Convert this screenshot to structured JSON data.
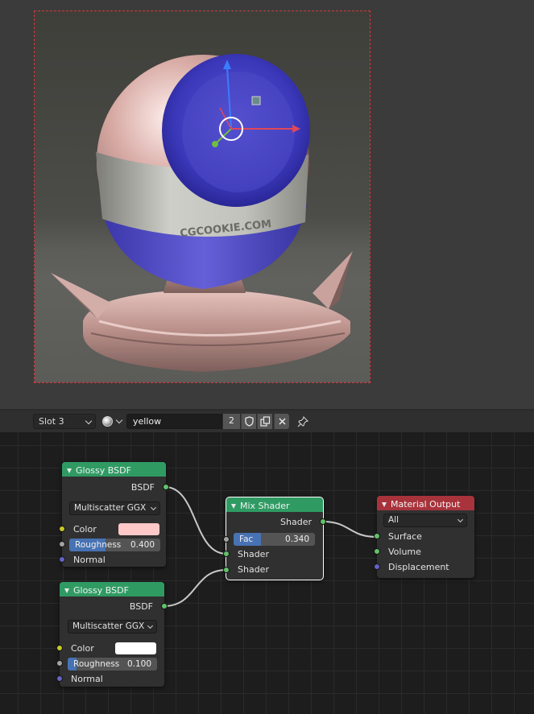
{
  "header": {
    "slot": "Slot 3",
    "material_name": "yellow",
    "user_count": "2",
    "icons": {
      "browse": "material-sphere-icon",
      "fake_user": "shield-icon",
      "duplicate": "duplicate-icon",
      "unlink": "close-icon",
      "pin": "pin-icon"
    }
  },
  "render": {
    "label_text": "CGCOOKIE.COM",
    "gizmo_colors": {
      "x": "#e0485a",
      "y": "#6fbe3f",
      "z": "#3a7dff"
    }
  },
  "nodes": {
    "glossy1": {
      "title": "Glossy BSDF",
      "output": "BSDF",
      "distribution": "Multiscatter GGX",
      "color_label": "Color",
      "color_value": "#ffc8c8",
      "roughness_label": "Roughness",
      "roughness": "0.400",
      "roughness_fraction": 0.4,
      "normal_label": "Normal"
    },
    "glossy2": {
      "title": "Glossy BSDF",
      "output": "BSDF",
      "distribution": "Multiscatter GGX",
      "color_label": "Color",
      "color_value": "#ffffff",
      "roughness_label": "Roughness",
      "roughness": "0.100",
      "roughness_fraction": 0.1,
      "normal_label": "Normal"
    },
    "mix": {
      "title": "Mix Shader",
      "output": "Shader",
      "fac_label": "Fac",
      "fac": "0.340",
      "fac_fraction": 0.34,
      "input1": "Shader",
      "input2": "Shader"
    },
    "output": {
      "title": "Material Output",
      "target": "All",
      "surface": "Surface",
      "volume": "Volume",
      "displacement": "Displacement"
    }
  },
  "colors": {
    "shader_socket": "#62c26b",
    "color_socket": "#c7c729",
    "value_socket": "#a3a3a3",
    "vector_socket": "#6363c7",
    "shader_header": "#2f9b63",
    "output_header": "#a8333b",
    "slider_fill": "#4772b3"
  }
}
